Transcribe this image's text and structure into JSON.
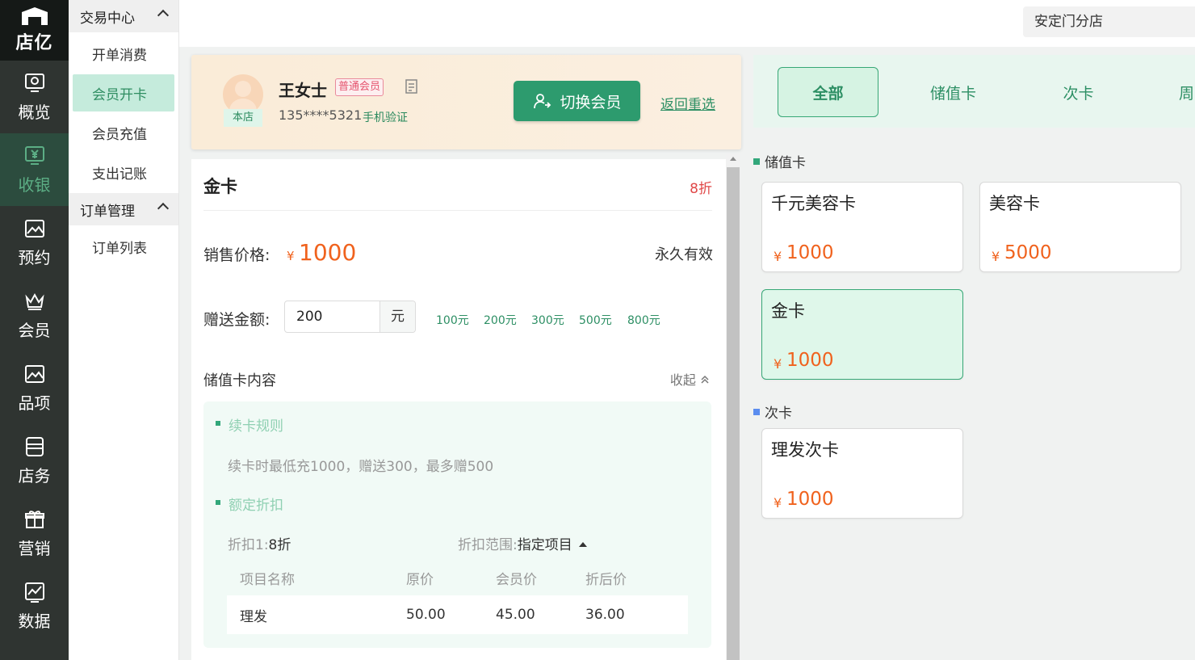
{
  "logo": {
    "text": "店亿"
  },
  "rail": [
    {
      "key": "overview",
      "label": "概览",
      "icon": "dashboard-icon"
    },
    {
      "key": "cashier",
      "label": "收银",
      "icon": "yen-monitor-icon",
      "active": true
    },
    {
      "key": "booking",
      "label": "预约",
      "icon": "image-frame-icon"
    },
    {
      "key": "member",
      "label": "会员",
      "icon": "crown-icon"
    },
    {
      "key": "items",
      "label": "品项",
      "icon": "picture-icon"
    },
    {
      "key": "store",
      "label": "店务",
      "icon": "box-icon"
    },
    {
      "key": "marketing",
      "label": "营销",
      "icon": "gift-icon"
    },
    {
      "key": "data",
      "label": "数据",
      "icon": "chart-icon"
    }
  ],
  "submenu": {
    "group1": "交易中心",
    "items1": [
      "开单消费",
      "会员开卡",
      "会员充值",
      "支出记账"
    ],
    "group2": "订单管理",
    "items2": [
      "订单列表"
    ],
    "active": "会员开卡"
  },
  "topbar": {
    "store": "安定门分店"
  },
  "member": {
    "tag": "本店",
    "name": "王女士",
    "level": "普通会员",
    "phone": "135****5321",
    "verify": "手机验证",
    "switch_label": "切换会员",
    "back_label": "返回重选"
  },
  "detail": {
    "title": "金卡",
    "discount": "8折",
    "price_label": "销售价格:",
    "price_currency": "¥",
    "price": "1000",
    "validity": "永久有效",
    "gift_label": "赠送金额:",
    "gift_value": "200",
    "gift_unit": "元",
    "quick_amounts": [
      "100元",
      "200元",
      "300元",
      "500元",
      "800元"
    ],
    "content_label": "储值卡内容",
    "collapse_label": "收起",
    "rule_title": "续卡规则",
    "rule_text": "续卡时最低充1000，赠送300，最多赠500",
    "discount_title": "额定折扣",
    "discount1_label": "折扣1:",
    "discount1_value": "8折",
    "scope_label": "折扣范围:",
    "scope_value": "指定项目",
    "table_headers": [
      "项目名称",
      "原价",
      "会员价",
      "折后价"
    ],
    "table_rows": [
      [
        "理发",
        "50.00",
        "45.00",
        "36.00"
      ]
    ]
  },
  "tabs": [
    "全部",
    "储值卡",
    "次卡",
    "周"
  ],
  "categories": [
    {
      "name": "储值卡",
      "color": "#32a77a"
    },
    {
      "name": "次卡",
      "color": "#5b8def"
    }
  ],
  "cards": [
    {
      "name": "千元美容卡",
      "currency": "¥",
      "price": "1000",
      "category": "储值卡"
    },
    {
      "name": "美容卡",
      "currency": "¥",
      "price": "5000",
      "category": "储值卡"
    },
    {
      "name": "金卡",
      "currency": "¥",
      "price": "1000",
      "category": "储值卡",
      "selected": true
    },
    {
      "name": "理发次卡",
      "currency": "¥",
      "price": "1000",
      "category": "次卡"
    }
  ]
}
